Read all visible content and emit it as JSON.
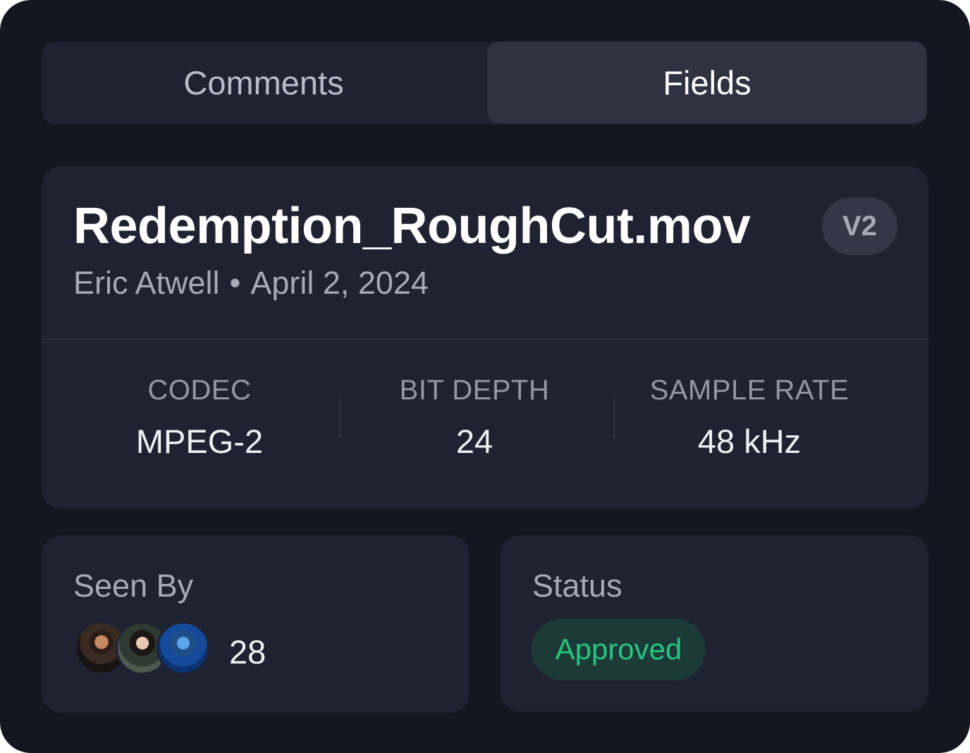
{
  "tabs": [
    {
      "label": "Comments",
      "active": false
    },
    {
      "label": "Fields",
      "active": true
    }
  ],
  "file": {
    "name": "Redemption_RoughCut.mov",
    "version": "V2",
    "author": "Eric Atwell",
    "separator": "•",
    "date": "April 2, 2024"
  },
  "specs": {
    "codec": {
      "label": "CODEC",
      "value": "MPEG-2"
    },
    "bit_depth": {
      "label": "BIT DEPTH",
      "value": "24"
    },
    "sample_rate": {
      "label": "SAMPLE RATE",
      "value": "48 kHz"
    }
  },
  "seen_by": {
    "label": "Seen By",
    "count": "28",
    "avatars": [
      "avatar-man-beard",
      "avatar-woman-dark-hair",
      "avatar-man-blue-light"
    ]
  },
  "status": {
    "label": "Status",
    "value": "Approved",
    "color": "#27c47d"
  },
  "colors": {
    "background": "#141720",
    "card": "#1f2230",
    "active_tab": "#2f3241",
    "status_green": "#27c47d",
    "status_pill": "#1c3a38"
  }
}
